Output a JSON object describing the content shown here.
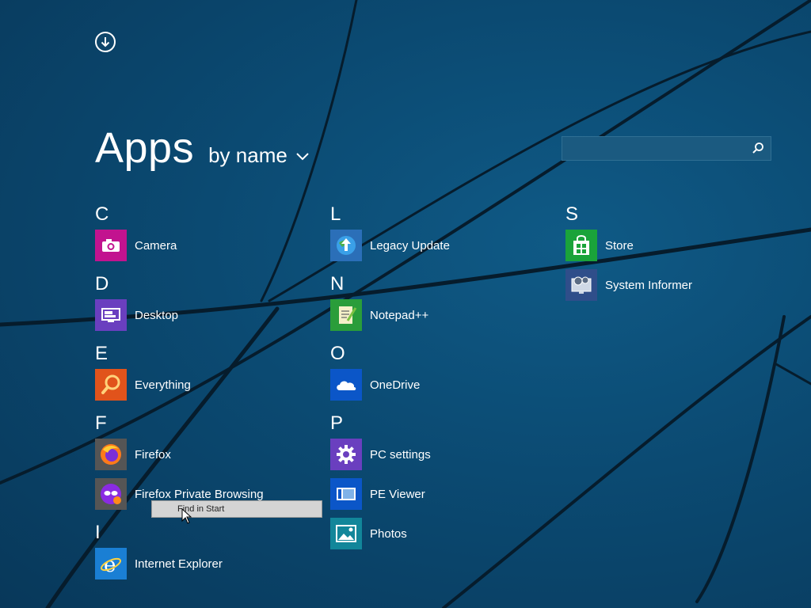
{
  "header": {
    "title": "Apps",
    "sort_label": "by name"
  },
  "search": {
    "placeholder": ""
  },
  "columns": [
    {
      "groups": [
        {
          "letter": "C",
          "apps": [
            {
              "label": "Camera",
              "icon": "camera-icon",
              "color": "#c2138f"
            }
          ]
        },
        {
          "letter": "D",
          "apps": [
            {
              "label": "Desktop",
              "icon": "desktop-icon",
              "color": "#6a3fbf"
            }
          ]
        },
        {
          "letter": "E",
          "apps": [
            {
              "label": "Everything",
              "icon": "everything-icon",
              "color": "#e1531b"
            }
          ]
        },
        {
          "letter": "F",
          "apps": [
            {
              "label": "Firefox",
              "icon": "firefox-icon",
              "color": "#555555"
            },
            {
              "label": "Firefox Private Browsing",
              "icon": "firefox-private-icon",
              "color": "#555555"
            }
          ]
        },
        {
          "letter": "I",
          "apps": [
            {
              "label": "Internet Explorer",
              "icon": "internet-explorer-icon",
              "color": "#1a7fd4"
            }
          ]
        }
      ]
    },
    {
      "groups": [
        {
          "letter": "L",
          "apps": [
            {
              "label": "Legacy Update",
              "icon": "legacy-update-icon",
              "color": "#2b6fb8"
            }
          ]
        },
        {
          "letter": "N",
          "apps": [
            {
              "label": "Notepad++",
              "icon": "notepadpp-icon",
              "color": "#2a9d3a"
            }
          ]
        },
        {
          "letter": "O",
          "apps": [
            {
              "label": "OneDrive",
              "icon": "onedrive-icon",
              "color": "#0b56c8"
            }
          ]
        },
        {
          "letter": "P",
          "apps": [
            {
              "label": "PC settings",
              "icon": "gear-icon",
              "color": "#6a3fbf"
            },
            {
              "label": "PE Viewer",
              "icon": "pe-viewer-icon",
              "color": "#0b56c8"
            },
            {
              "label": "Photos",
              "icon": "photos-icon",
              "color": "#12869a"
            }
          ]
        }
      ]
    },
    {
      "groups": [
        {
          "letter": "S",
          "apps": [
            {
              "label": "Store",
              "icon": "store-icon",
              "color": "#1aa33a"
            },
            {
              "label": "System Informer",
              "icon": "system-informer-icon",
              "color": "#2f4e8a"
            }
          ]
        }
      ]
    }
  ],
  "context_menu": {
    "label": "Find in Start"
  }
}
